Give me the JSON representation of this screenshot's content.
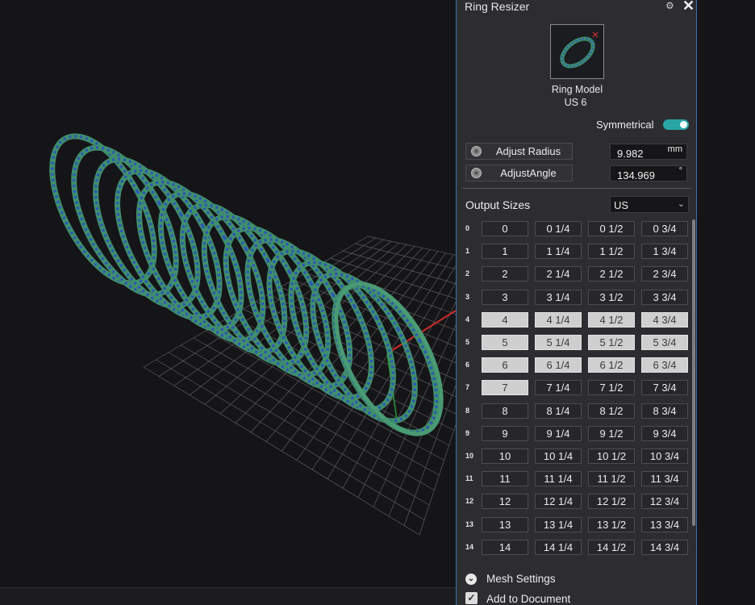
{
  "panel": {
    "title": "Ring Resizer",
    "settings_icon": "gear-icon",
    "close_icon": "close-icon",
    "close_glyph": "✕",
    "gear_glyph": "⚙"
  },
  "model": {
    "name": "Ring Model",
    "size": "US 6"
  },
  "symmetrical": {
    "label": "Symmetrical",
    "on": true
  },
  "adjust_radius": {
    "label": "Adjust Radius",
    "value": "9.982",
    "unit": "mm"
  },
  "adjust_angle": {
    "label": "AdjustAngle",
    "value": "134.969",
    "unit": "°"
  },
  "output": {
    "label": "Output Sizes",
    "selected": "US",
    "chevron": "⌄",
    "rows": [
      {
        "label": "0",
        "cells": [
          "0",
          "0 1/4",
          "0 1/2",
          "0 3/4"
        ],
        "selected": [
          false,
          false,
          false,
          false
        ]
      },
      {
        "label": "1",
        "cells": [
          "1",
          "1 1/4",
          "1 1/2",
          "1 3/4"
        ],
        "selected": [
          false,
          false,
          false,
          false
        ]
      },
      {
        "label": "2",
        "cells": [
          "2",
          "2 1/4",
          "2 1/2",
          "2 3/4"
        ],
        "selected": [
          false,
          false,
          false,
          false
        ]
      },
      {
        "label": "3",
        "cells": [
          "3",
          "3 1/4",
          "3 1/2",
          "3 3/4"
        ],
        "selected": [
          false,
          false,
          false,
          false
        ]
      },
      {
        "label": "4",
        "cells": [
          "4",
          "4 1/4",
          "4 1/2",
          "4 3/4"
        ],
        "selected": [
          true,
          true,
          true,
          true
        ]
      },
      {
        "label": "5",
        "cells": [
          "5",
          "5 1/4",
          "5 1/2",
          "5 3/4"
        ],
        "selected": [
          true,
          true,
          true,
          true
        ]
      },
      {
        "label": "6",
        "cells": [
          "6",
          "6 1/4",
          "6 1/2",
          "6 3/4"
        ],
        "selected": [
          true,
          true,
          true,
          true
        ]
      },
      {
        "label": "7",
        "cells": [
          "7",
          "7 1/4",
          "7 1/2",
          "7 3/4"
        ],
        "selected": [
          true,
          false,
          false,
          false
        ]
      },
      {
        "label": "8",
        "cells": [
          "8",
          "8 1/4",
          "8 1/2",
          "8 3/4"
        ],
        "selected": [
          false,
          false,
          false,
          false
        ]
      },
      {
        "label": "9",
        "cells": [
          "9",
          "9 1/4",
          "9 1/2",
          "9 3/4"
        ],
        "selected": [
          false,
          false,
          false,
          false
        ]
      },
      {
        "label": "10",
        "cells": [
          "10",
          "10 1/4",
          "10 1/2",
          "10 3/4"
        ],
        "selected": [
          false,
          false,
          false,
          false
        ]
      },
      {
        "label": "11",
        "cells": [
          "11",
          "11 1/4",
          "11 1/2",
          "11 3/4"
        ],
        "selected": [
          false,
          false,
          false,
          false
        ]
      },
      {
        "label": "12",
        "cells": [
          "12",
          "12 1/4",
          "12 1/2",
          "12 3/4"
        ],
        "selected": [
          false,
          false,
          false,
          false
        ]
      },
      {
        "label": "13",
        "cells": [
          "13",
          "13 1/4",
          "13 1/2",
          "13 3/4"
        ],
        "selected": [
          false,
          false,
          false,
          false
        ]
      },
      {
        "label": "14",
        "cells": [
          "14",
          "14 1/4",
          "14 1/2",
          "14 3/4"
        ],
        "selected": [
          false,
          false,
          false,
          false
        ]
      }
    ]
  },
  "mesh_settings": {
    "label": "Mesh Settings",
    "icon": "chevron-down-icon",
    "glyph": "⌄"
  },
  "add_to_document": {
    "label": "Add to Document",
    "checked": true,
    "glyph": "✓"
  },
  "colors": {
    "panel_bg": "#2d2d31",
    "accent_toggle": "#2aa5a5",
    "panel_border": "#3b6fae",
    "ring_green": "#3f8f6a",
    "gem_blue": "#2f55b8",
    "viewport_bg": "#151518",
    "selected_cell": "#cfcfcf"
  }
}
